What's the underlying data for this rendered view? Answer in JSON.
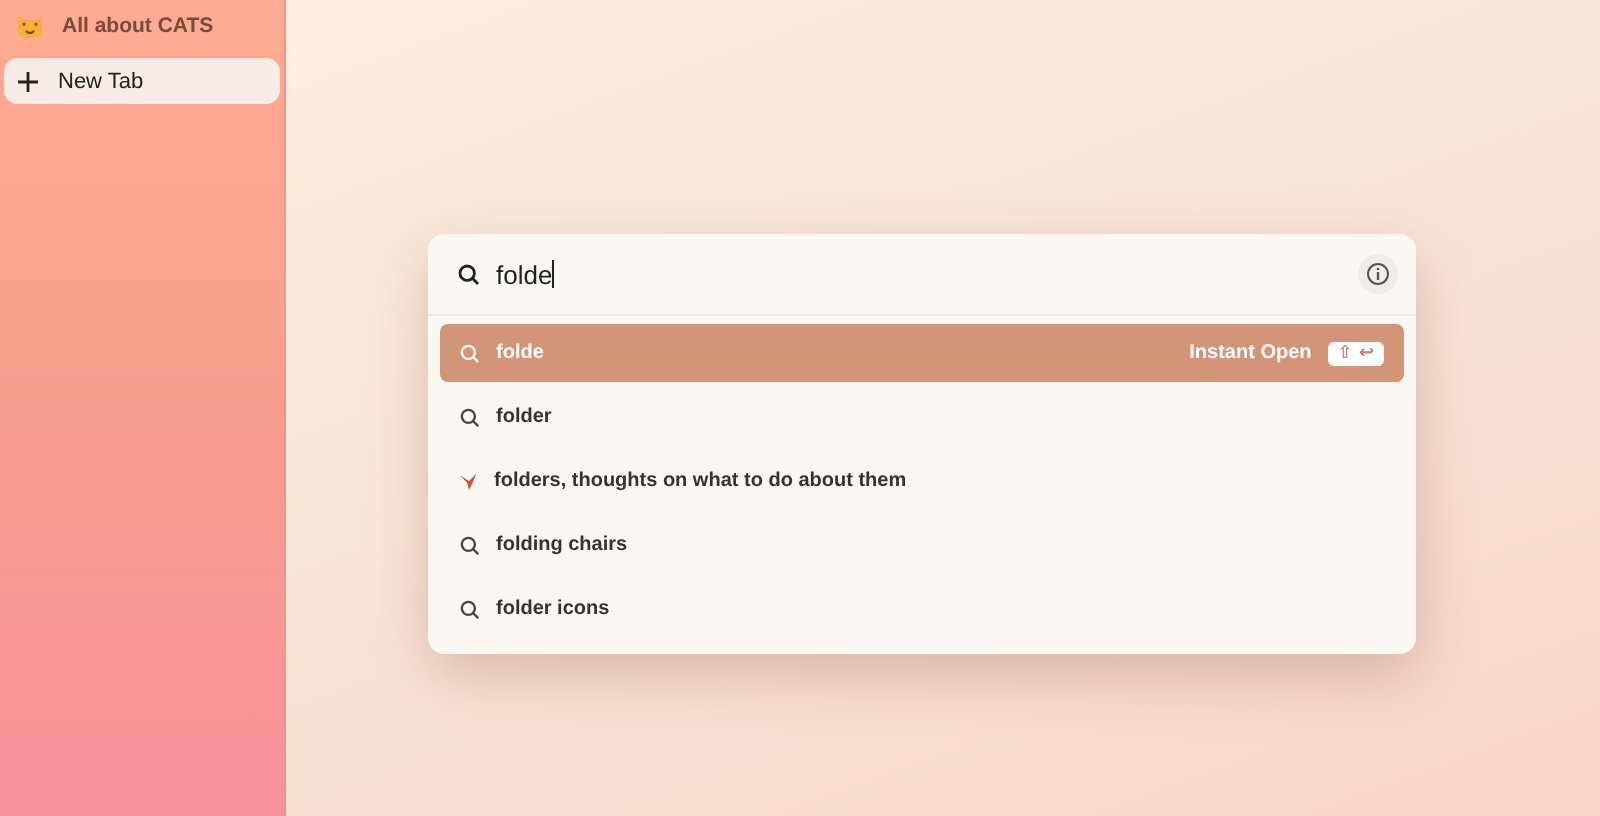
{
  "sidebar": {
    "space": {
      "title": "All about CATS"
    },
    "new_tab": {
      "label": "New Tab"
    }
  },
  "command_bar": {
    "query": "folde",
    "results": [
      {
        "kind": "search",
        "text": "folde",
        "selected": true,
        "action": "Instant Open",
        "shortcut": "⇧ ↩"
      },
      {
        "kind": "search",
        "text": "folder",
        "selected": false
      },
      {
        "kind": "suggestion",
        "text": "folders, thoughts on what to do about them",
        "selected": false
      },
      {
        "kind": "search",
        "text": "folding chairs",
        "selected": false
      },
      {
        "kind": "search",
        "text": "folder icons",
        "selected": false
      }
    ]
  }
}
